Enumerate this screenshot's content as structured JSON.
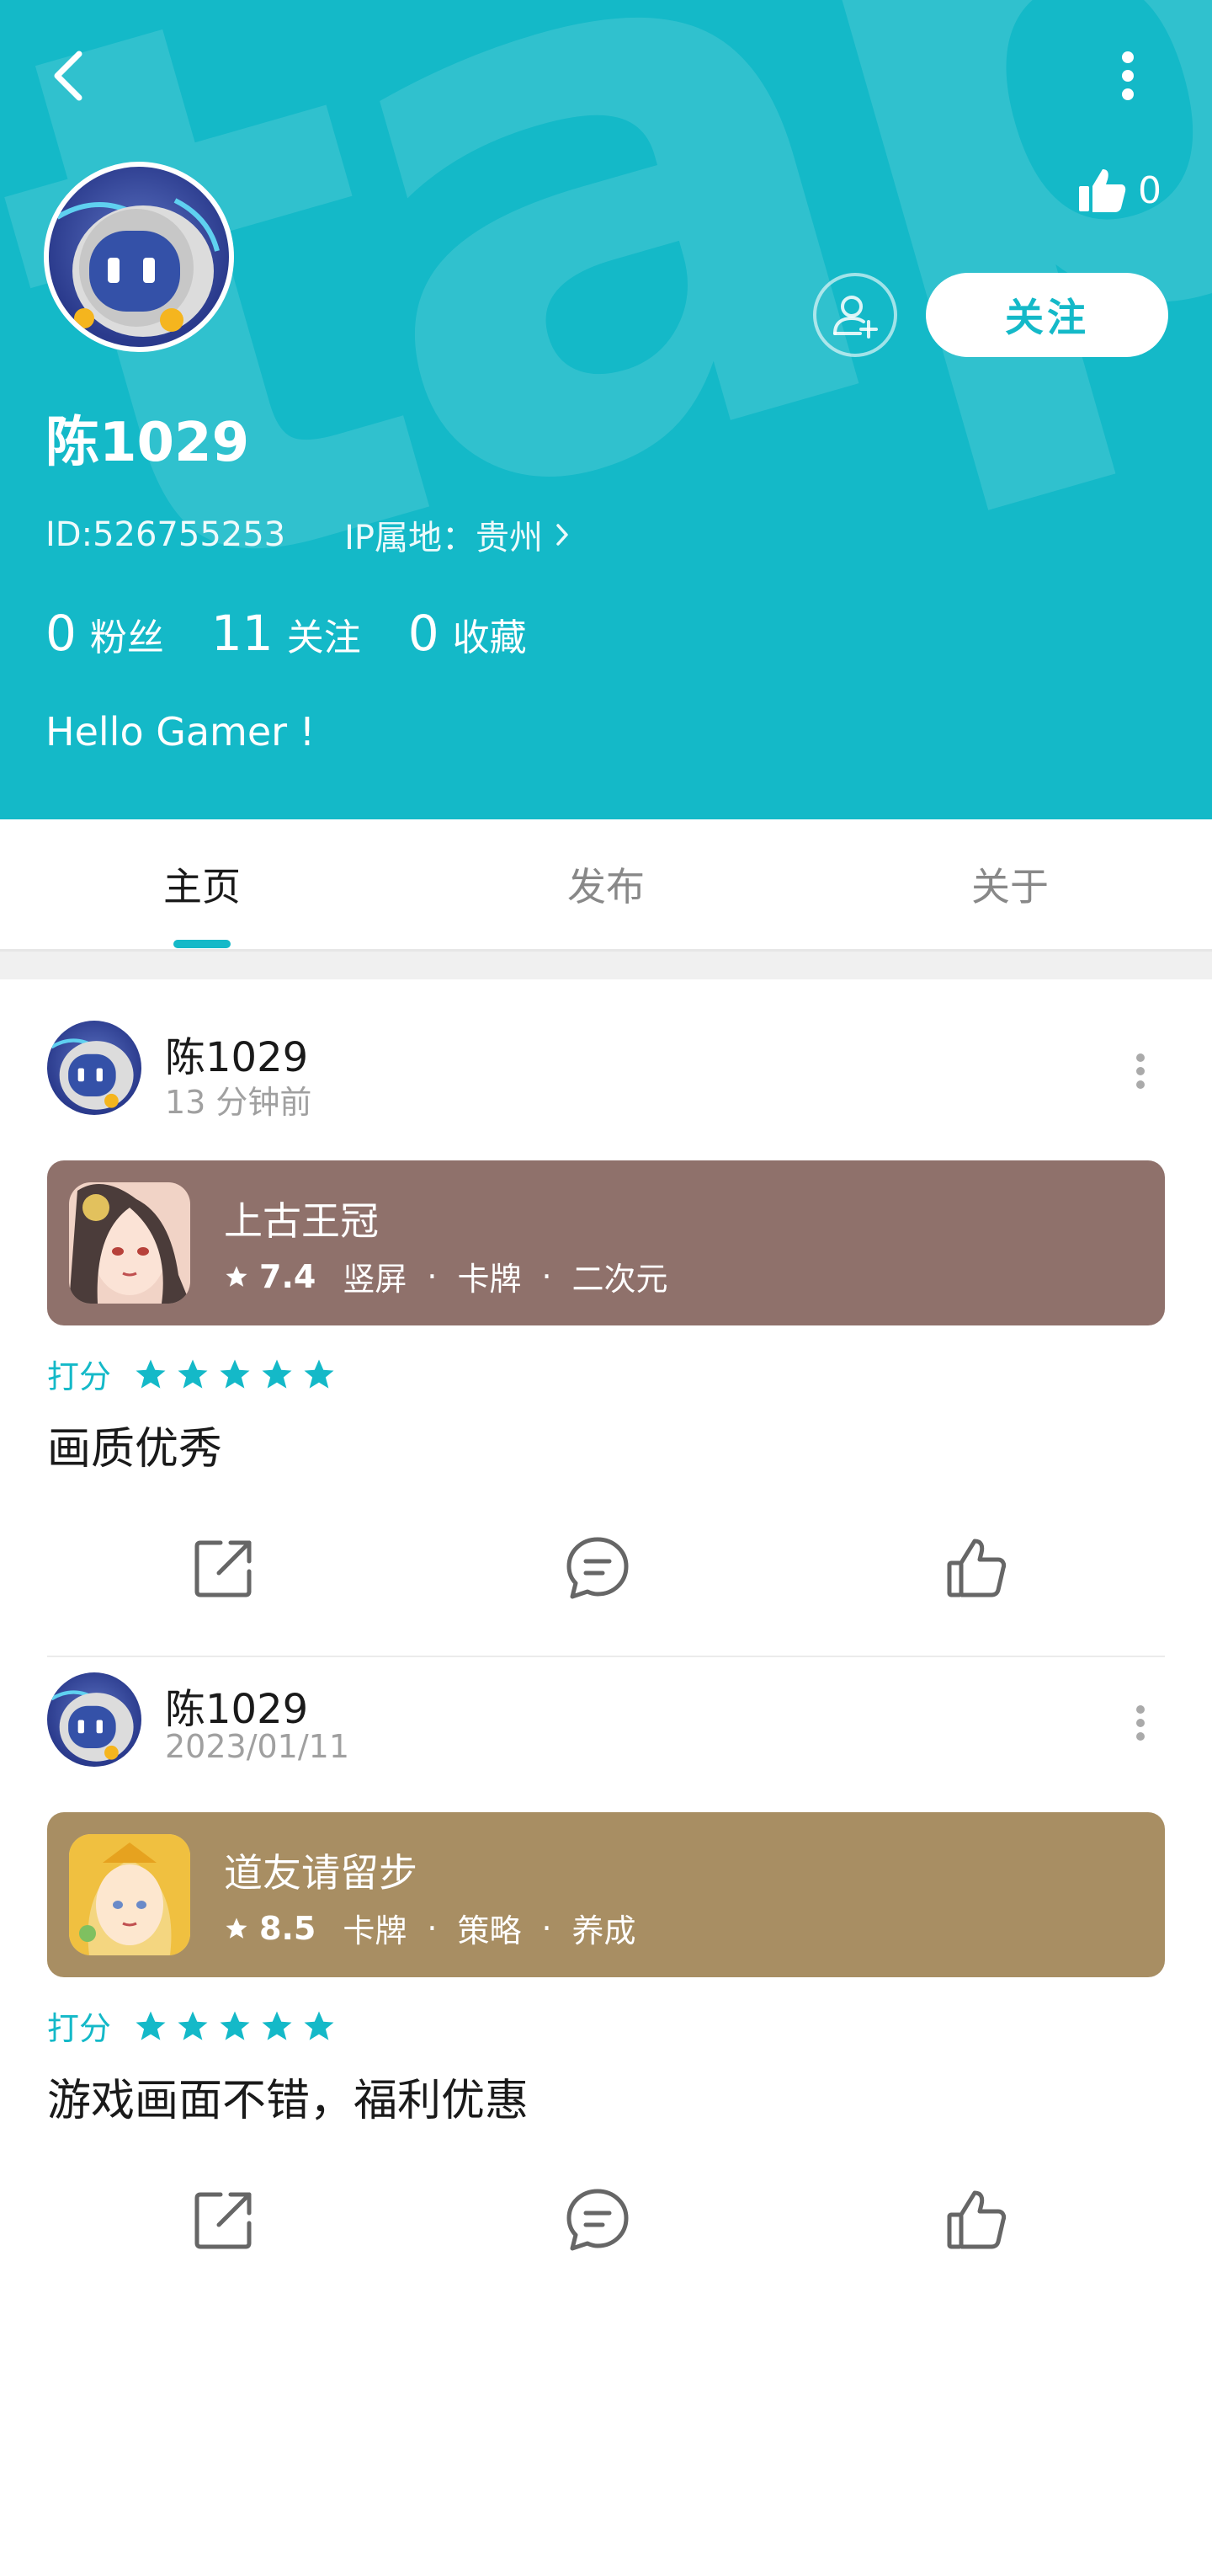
{
  "header": {
    "watermark": "tapta",
    "like_count": "0",
    "follow_label": "关注",
    "username": "陈1029",
    "user_id": "ID:526755253",
    "ip_label": "IP属地：贵州",
    "stats": [
      {
        "num": "0",
        "label": "粉丝"
      },
      {
        "num": "11",
        "label": "关注"
      },
      {
        "num": "0",
        "label": "收藏"
      }
    ],
    "bio": "Hello Gamer !",
    "bg_color": "#14b9c8"
  },
  "tabs": [
    {
      "label": "主页",
      "active": true
    },
    {
      "label": "发布",
      "active": false
    },
    {
      "label": "关于",
      "active": false
    }
  ],
  "posts": [
    {
      "author": "陈1029",
      "time": "13 分钟前",
      "game": {
        "name": "上古王冠",
        "score": "7.4",
        "tags": [
          "竖屏",
          "卡牌",
          "二次元"
        ],
        "card_color": "#8f716b"
      },
      "rating_label": "打分",
      "stars": 5,
      "text": "画质优秀"
    },
    {
      "author": "陈1029",
      "time": "2023/01/11",
      "game": {
        "name": "道友请留步",
        "score": "8.5",
        "tags": [
          "卡牌",
          "策略",
          "养成"
        ],
        "card_color": "#a88e63"
      },
      "rating_label": "打分",
      "stars": 5,
      "text": "游戏画面不错，福利优惠"
    }
  ],
  "icons": {
    "back": "chevron-left-icon",
    "more": "more-vertical-icon",
    "like": "thumbs-up-icon",
    "add_friend": "add-user-icon",
    "share": "share-icon",
    "comment": "comment-icon",
    "star": "star-icon"
  },
  "accent_color": "#14b9c8"
}
